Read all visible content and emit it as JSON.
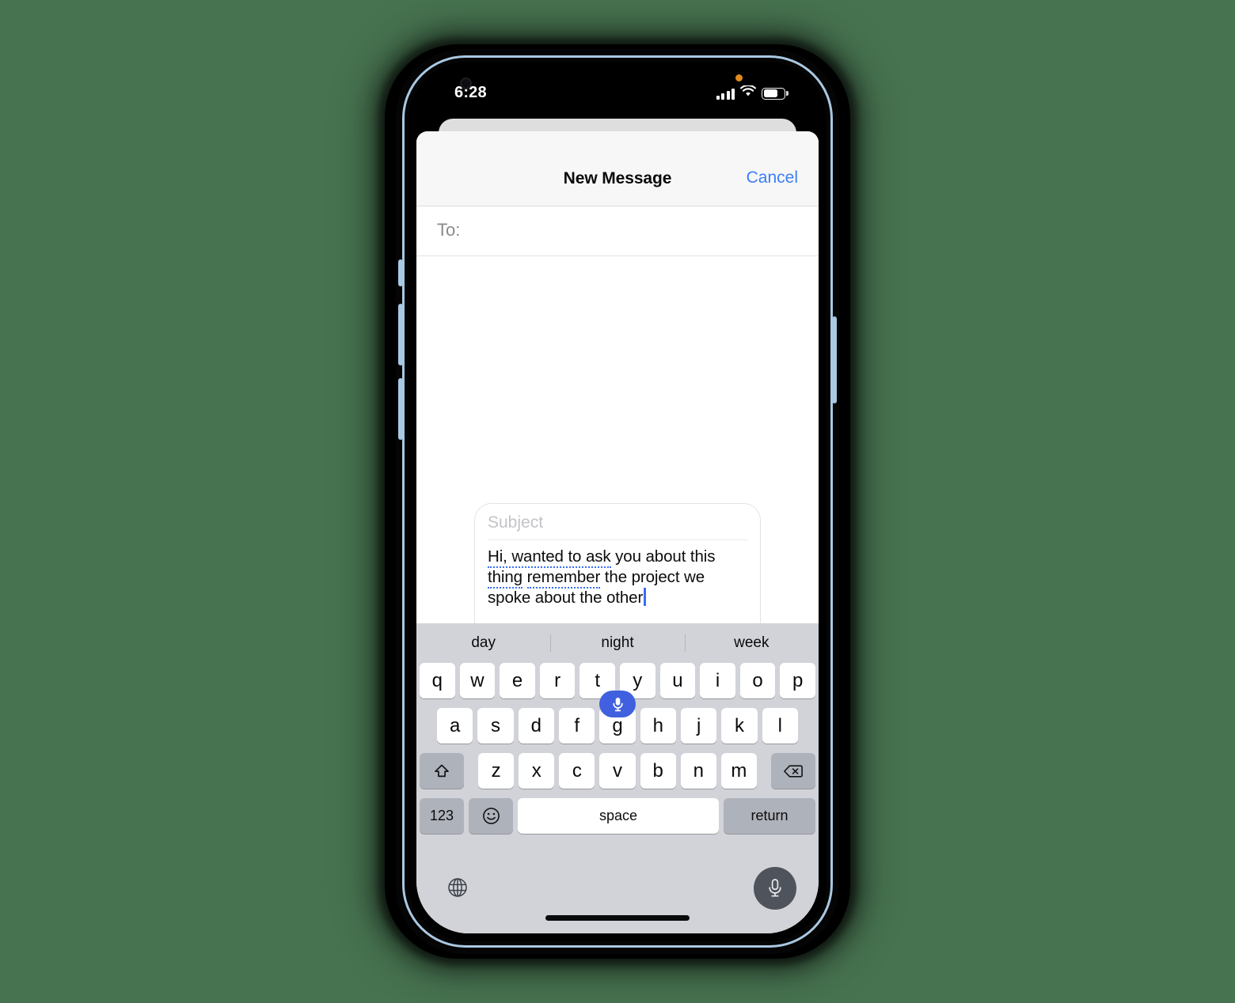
{
  "device": {
    "frame_color": "#a9c8e2",
    "background_color": "#477350"
  },
  "status_bar": {
    "time": "6:28",
    "cellular_icon": "signal-bars-icon",
    "wifi_icon": "wifi-icon",
    "battery_icon": "battery-icon",
    "battery_level_percent": 72,
    "privacy_indicator": "microphone-in-use-dot",
    "privacy_color": "#e08a1e"
  },
  "nav": {
    "title": "New Message",
    "cancel_label": "Cancel",
    "accent_color": "#3b7ff5"
  },
  "recipient": {
    "label": "To:",
    "value": ""
  },
  "compose": {
    "subject_placeholder": "Subject",
    "message_dictated_1": "Hi, wanted to ask",
    "message_plain_1": " you about this ",
    "message_dictated_2a": "thing",
    "message_plain_2a": " ",
    "message_dictated_2b": "remember",
    "message_plain_2": " the project we spoke about the other",
    "full_text": "Hi, wanted to ask you about this thing remember the project we spoke about the other",
    "plus_icon": "plus-icon",
    "send_icon": "send-arrow-up-icon",
    "mic_pill_icon": "microphone-icon",
    "mic_pill_color": "#4060df",
    "dictation_underline_color": "#3b6ef5",
    "caret_color": "#3b6ef5"
  },
  "keyboard": {
    "suggestions": [
      "day",
      "night",
      "week"
    ],
    "row1": [
      "q",
      "w",
      "e",
      "r",
      "t",
      "y",
      "u",
      "i",
      "o",
      "p"
    ],
    "row2": [
      "a",
      "s",
      "d",
      "f",
      "g",
      "h",
      "j",
      "k",
      "l"
    ],
    "row3": [
      "z",
      "x",
      "c",
      "v",
      "b",
      "n",
      "m"
    ],
    "shift_icon": "shift-up-arrow-icon",
    "delete_icon": "backspace-delete-icon",
    "numeric_label": "123",
    "emoji_icon": "emoji-smiley-icon",
    "space_label": "space",
    "return_label": "return",
    "globe_icon": "globe-language-icon",
    "dictation_icon": "microphone-icon",
    "background_color": "#d1d3d9",
    "key_color": "#ffffff",
    "modifier_key_color": "#aeb2bb"
  }
}
